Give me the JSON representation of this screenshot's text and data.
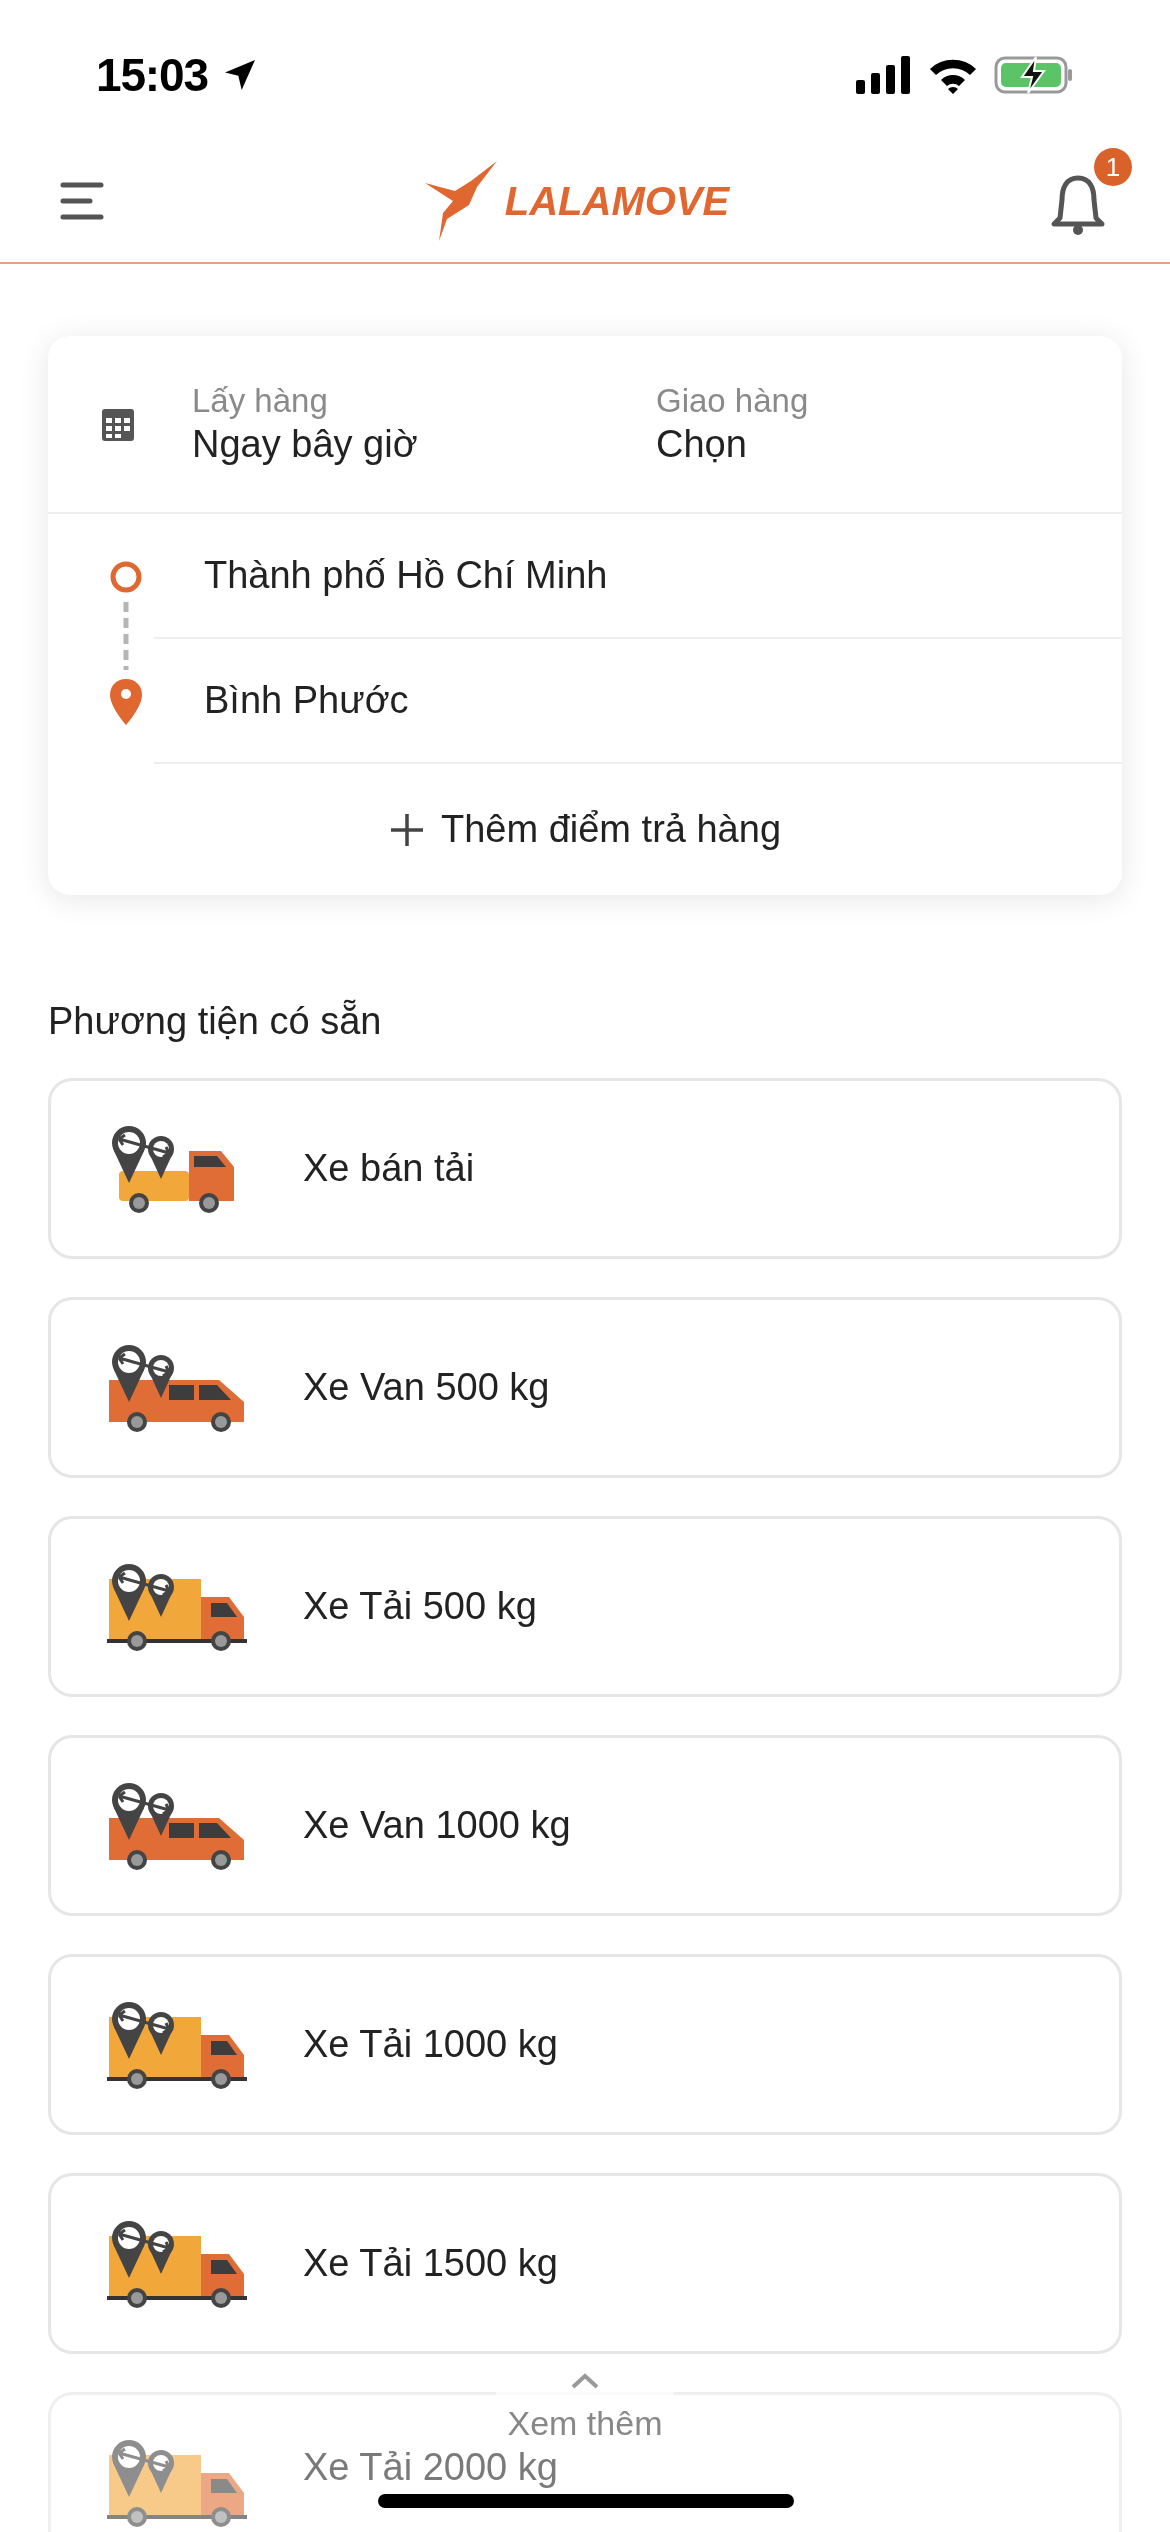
{
  "status_bar": {
    "time": "15:03"
  },
  "header": {
    "logo": "LALAMOVE",
    "notification_count": "1"
  },
  "schedule": {
    "pickup_label": "Lấy hàng",
    "pickup_value": "Ngay bây giờ",
    "delivery_label": "Giao hàng",
    "delivery_value": "Chọn"
  },
  "route": {
    "stops": [
      {
        "kind": "origin",
        "address": "Thành phố Hồ Chí Minh"
      },
      {
        "kind": "destination",
        "address": "Bình Phước"
      }
    ],
    "add_stop": "Thêm điểm trả hàng"
  },
  "vehicles_title": "Phương tiện có sẵn",
  "vehicles": [
    {
      "kind": "pickup",
      "name": "Xe bán tải"
    },
    {
      "kind": "van",
      "name": "Xe Van 500 kg"
    },
    {
      "kind": "truck",
      "name": "Xe Tải 500 kg"
    },
    {
      "kind": "van",
      "name": "Xe Van 1000 kg"
    },
    {
      "kind": "truck",
      "name": "Xe Tải 1000 kg"
    },
    {
      "kind": "truck",
      "name": "Xe Tải 1500 kg"
    },
    {
      "kind": "truck",
      "name": "Xe Tải 2000 kg"
    }
  ],
  "see_more": "Xem thêm"
}
